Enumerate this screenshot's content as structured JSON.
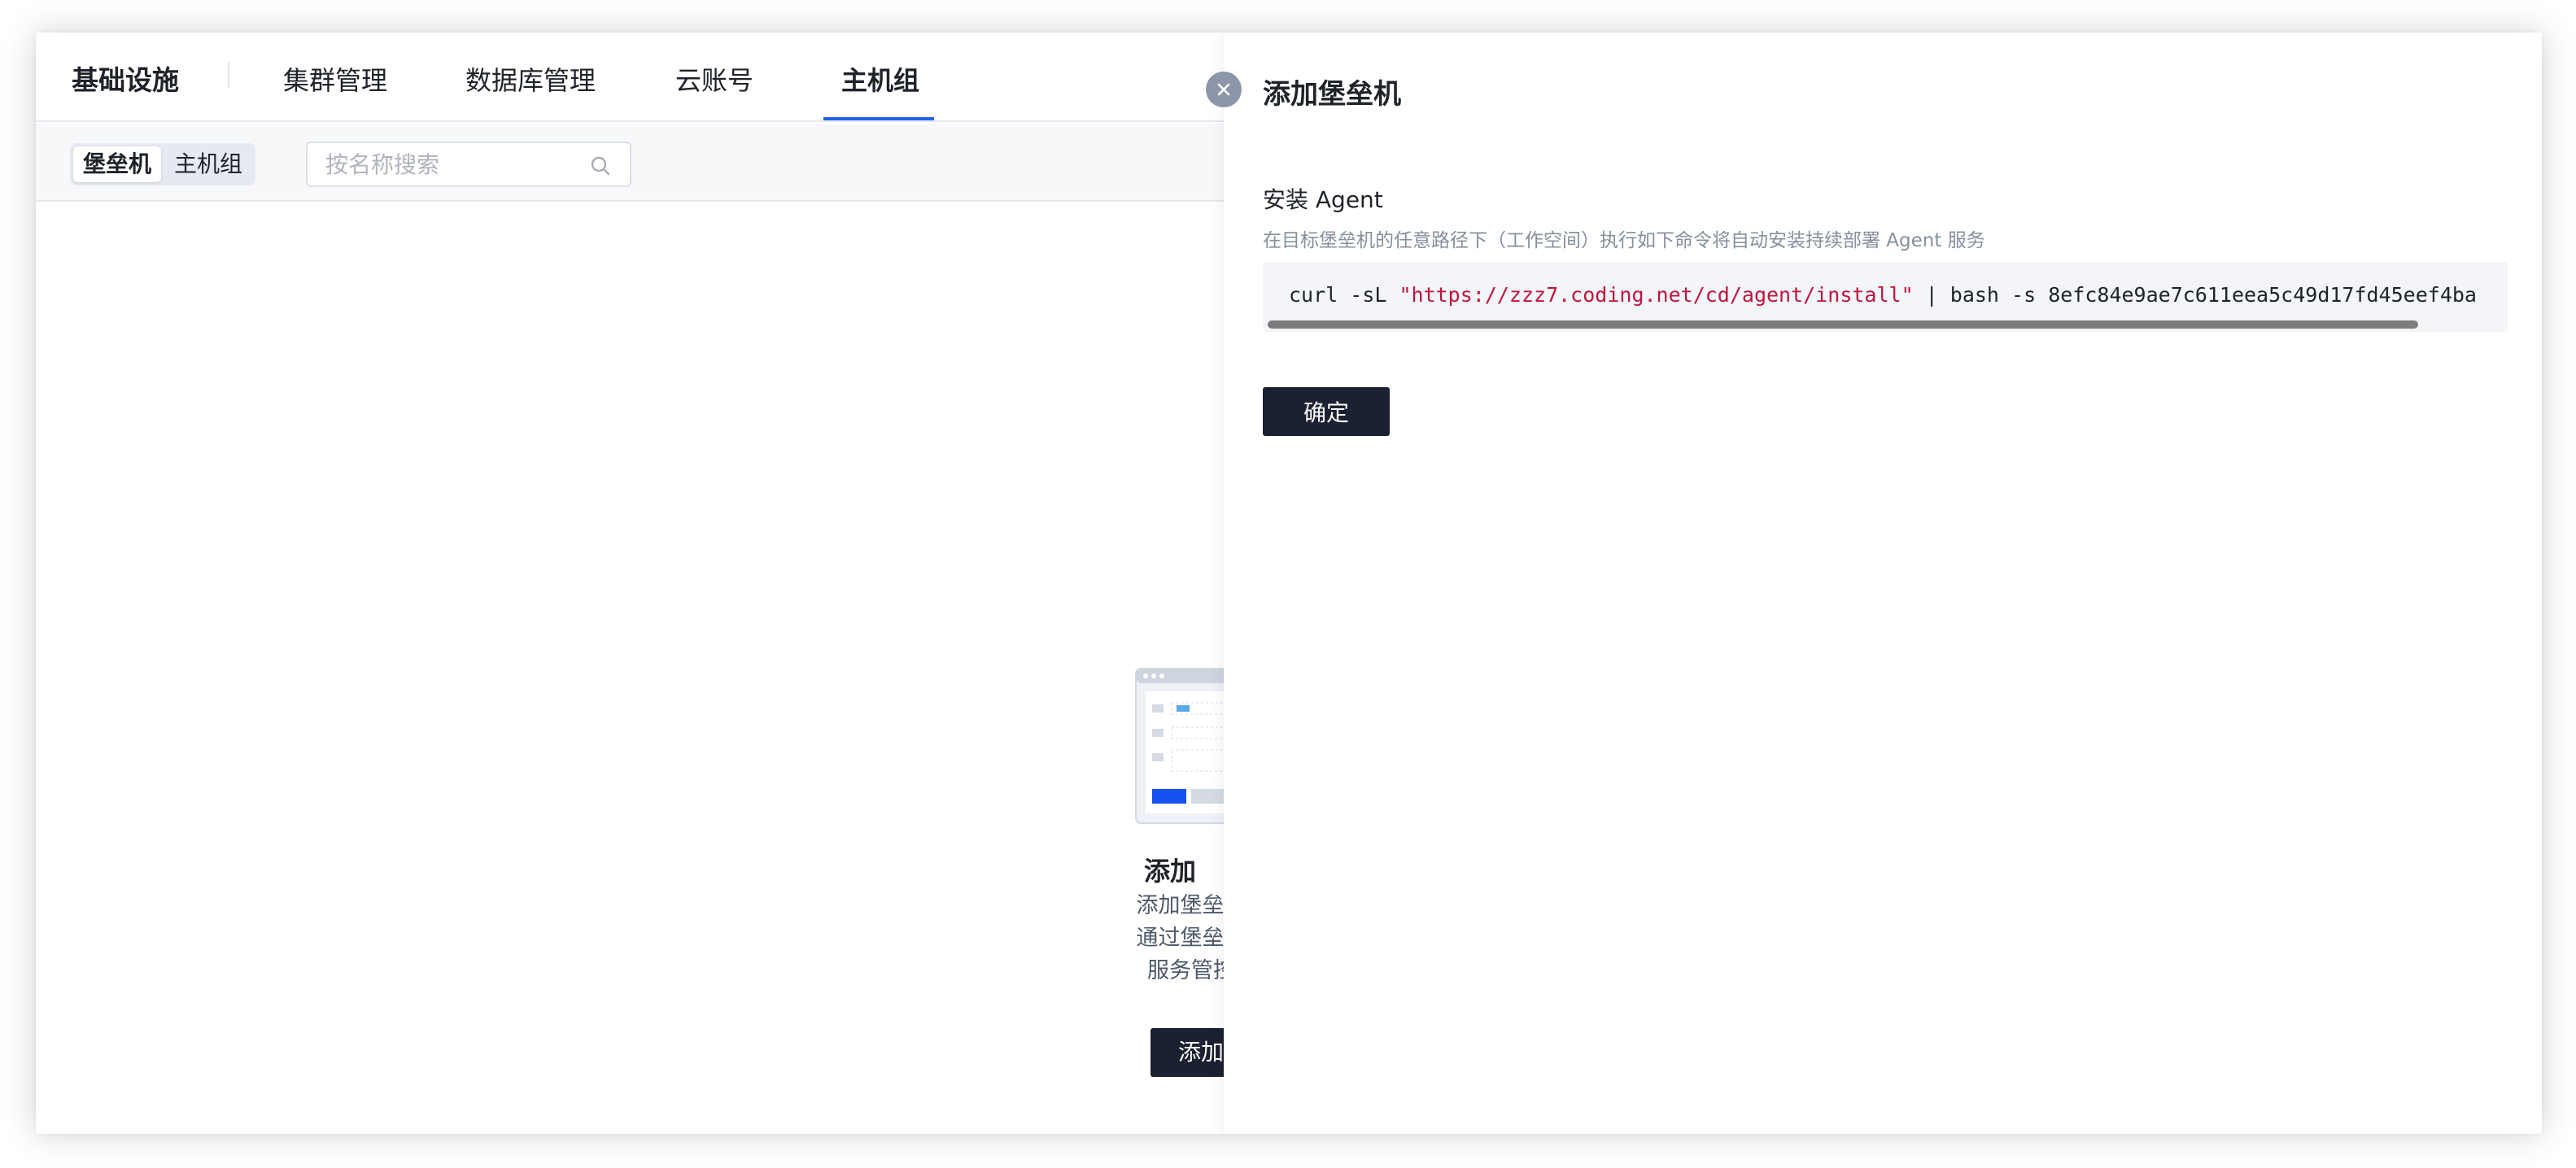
{
  "topnav": {
    "brand": "基础设施",
    "tabs": [
      {
        "label": "集群管理"
      },
      {
        "label": "数据库管理"
      },
      {
        "label": "云账号"
      },
      {
        "label": "主机组"
      }
    ],
    "active_tab": "主机组"
  },
  "subbar": {
    "segments": [
      {
        "label": "堡垒机"
      },
      {
        "label": "主机组"
      }
    ],
    "active_segment": "堡垒机",
    "search": {
      "placeholder": "按名称搜索",
      "value": "",
      "icon": "search-icon"
    }
  },
  "empty_state": {
    "title": "添加",
    "desc_lines": [
      "添加堡垒机",
      "通过堡垒机",
      "服务管控"
    ],
    "button": "添加"
  },
  "drawer": {
    "title": "添加堡垒机",
    "close_icon": "close-icon",
    "section_label": "安装 Agent",
    "section_desc": "在目标堡垒机的任意路径下（工作空间）执行如下命令将自动安装持续部署 Agent 服务",
    "command": {
      "prefix": "curl -sL ",
      "url": "\"https://zzz7.coding.net/cd/agent/install\"",
      "suffix": " | bash -s 8efc84e9ae7c611eea5c49d17fd45eef4ba"
    },
    "confirm_button": "确定"
  },
  "colors": {
    "accent": "#2563eb",
    "primary_button": "#1b2130",
    "code_string": "#c0143c"
  }
}
